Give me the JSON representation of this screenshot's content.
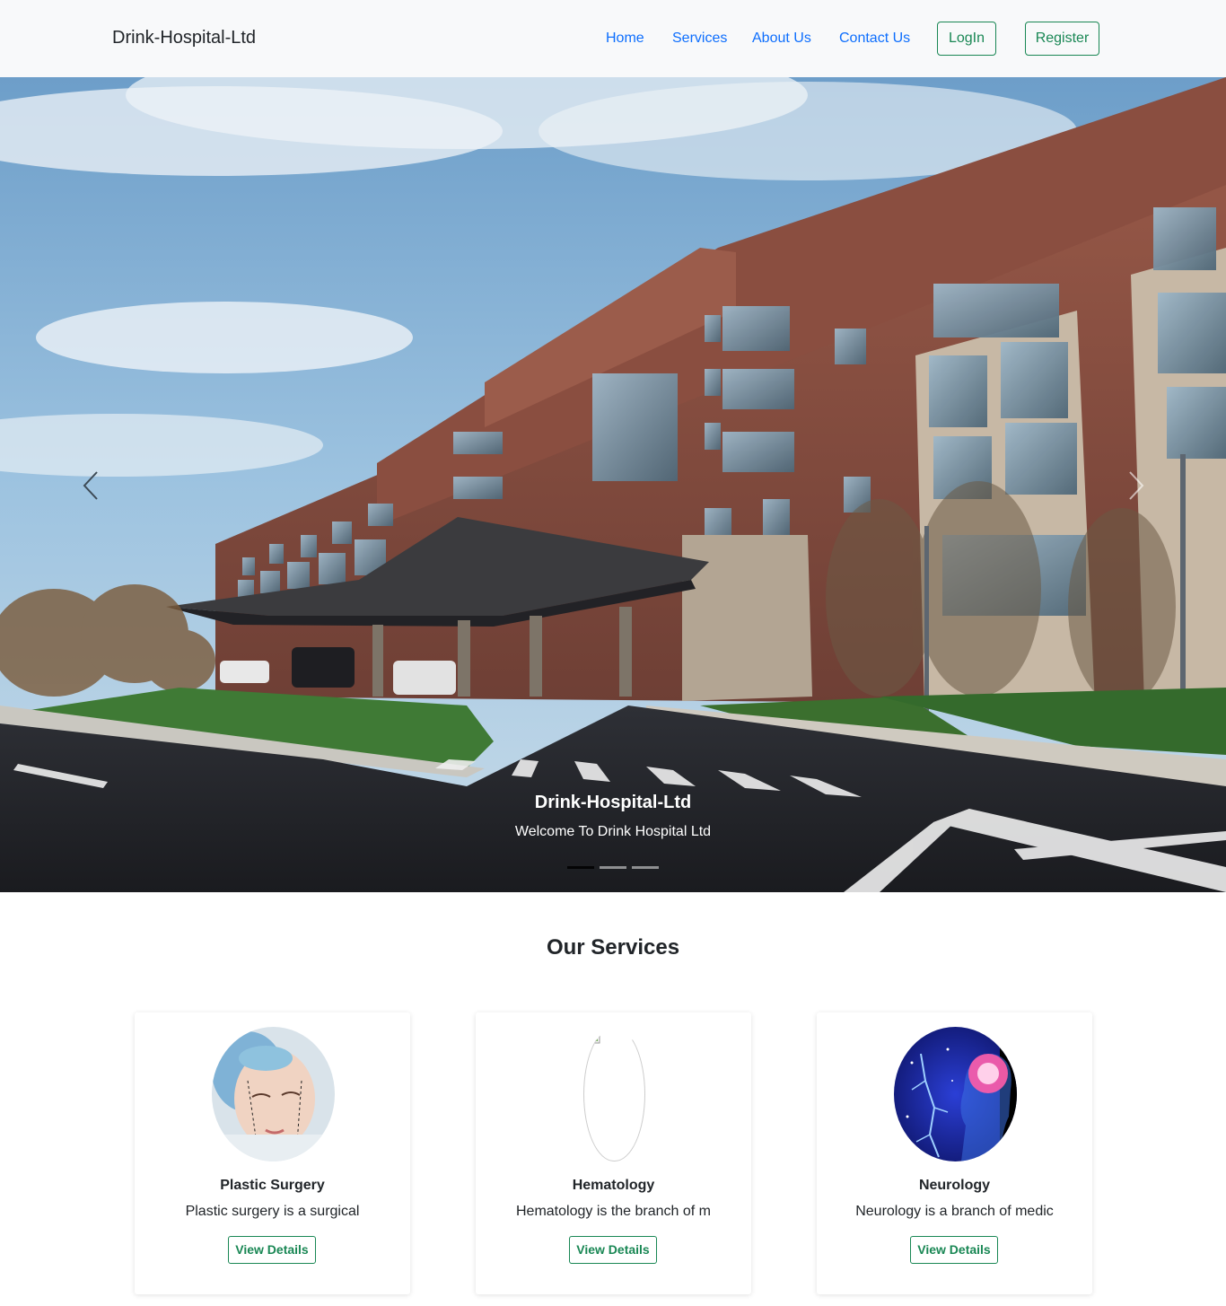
{
  "navbar": {
    "brand": "Drink-Hospital-Ltd",
    "links": [
      "Home",
      "Services",
      "About Us",
      "Contact Us"
    ],
    "login_label": "LogIn",
    "register_label": "Register"
  },
  "hero": {
    "title": "Drink-Hospital-Ltd",
    "subtitle": "Welcome To Drink Hospital Ltd",
    "active_slide": 1,
    "slide_count": 3
  },
  "services": {
    "heading": "Our Services",
    "cards": [
      {
        "title": "Plastic Surgery",
        "text": "Plastic surgery is a surgical",
        "button": "View Details",
        "image": "face-surgery-image"
      },
      {
        "title": "Hematology",
        "text": "Hematology is the branch of m",
        "button": "View Details",
        "image": "broken-image"
      },
      {
        "title": "Neurology",
        "text": "Neurology is a branch of medic",
        "button": "View Details",
        "image": "brain-neurology-image"
      }
    ]
  },
  "colors": {
    "navbar_bg": "#f8f9fa",
    "link": "#0d6efd",
    "success": "#198754"
  }
}
